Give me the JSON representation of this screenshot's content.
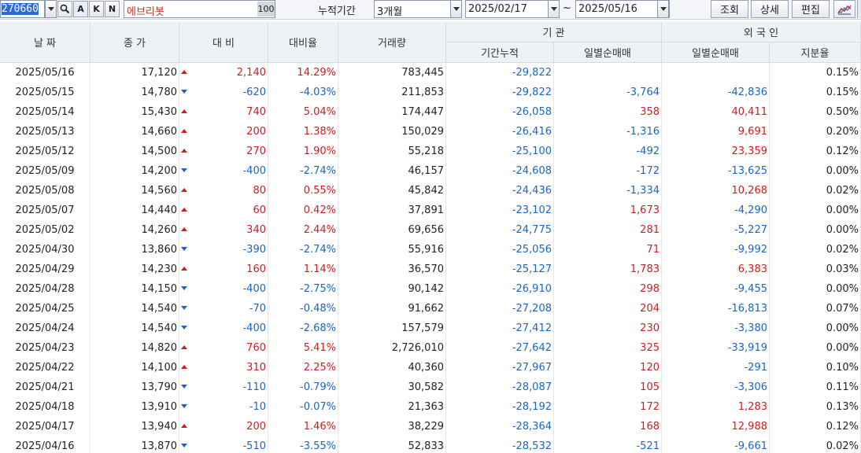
{
  "toolbar": {
    "stock_code": "270660",
    "buttons": [
      "A",
      "K",
      "N"
    ],
    "stock_name": "에브리봇",
    "count_badge": "100",
    "period_label": "누적기간",
    "period_value": "3개월",
    "date_from": "2025/02/17",
    "date_sep": "~",
    "date_to": "2025/05/16",
    "query_label": "조회",
    "detail_label": "상세",
    "edit_label": "편집"
  },
  "headers": {
    "date": "날 짜",
    "close": "종 가",
    "change": "대 비",
    "change_rate": "대비율",
    "volume": "거래량",
    "institution": "기    관",
    "inst_cum": "기간누적",
    "inst_daily": "일별순매매",
    "foreign": "외 국 인",
    "for_daily": "일별순매매",
    "for_share": "지분율"
  },
  "colors": {
    "up": "#d01d1d",
    "down": "#1a66c2",
    "header_bg": "#eef1f6"
  },
  "rows": [
    {
      "date": "2025/05/16",
      "close": "17,120",
      "dir": "up",
      "change": "2,140",
      "rate": "14.29%",
      "volume": "783,445",
      "inst_cum": "-29,822",
      "inst_daily": "",
      "for_daily": "",
      "share": "0.15%"
    },
    {
      "date": "2025/05/15",
      "close": "14,780",
      "dir": "down",
      "change": "-620",
      "rate": "-4.03%",
      "volume": "211,853",
      "inst_cum": "-29,822",
      "inst_daily": "-3,764",
      "for_daily": "-42,836",
      "share": "0.15%"
    },
    {
      "date": "2025/05/14",
      "close": "15,430",
      "dir": "up",
      "change": "740",
      "rate": "5.04%",
      "volume": "174,447",
      "inst_cum": "-26,058",
      "inst_daily": "358",
      "for_daily": "40,411",
      "share": "0.50%"
    },
    {
      "date": "2025/05/13",
      "close": "14,660",
      "dir": "up",
      "change": "200",
      "rate": "1.38%",
      "volume": "150,029",
      "inst_cum": "-26,416",
      "inst_daily": "-1,316",
      "for_daily": "9,691",
      "share": "0.20%"
    },
    {
      "date": "2025/05/12",
      "close": "14,500",
      "dir": "up",
      "change": "270",
      "rate": "1.90%",
      "volume": "55,218",
      "inst_cum": "-25,100",
      "inst_daily": "-492",
      "for_daily": "23,359",
      "share": "0.12%"
    },
    {
      "date": "2025/05/09",
      "close": "14,200",
      "dir": "down",
      "change": "-400",
      "rate": "-2.74%",
      "volume": "46,157",
      "inst_cum": "-24,608",
      "inst_daily": "-172",
      "for_daily": "-13,625",
      "share": "0.00%"
    },
    {
      "date": "2025/05/08",
      "close": "14,560",
      "dir": "up",
      "change": "80",
      "rate": "0.55%",
      "volume": "45,842",
      "inst_cum": "-24,436",
      "inst_daily": "-1,334",
      "for_daily": "10,268",
      "share": "0.02%"
    },
    {
      "date": "2025/05/07",
      "close": "14,440",
      "dir": "up",
      "change": "60",
      "rate": "0.42%",
      "volume": "37,891",
      "inst_cum": "-23,102",
      "inst_daily": "1,673",
      "for_daily": "-4,290",
      "share": "0.00%"
    },
    {
      "date": "2025/05/02",
      "close": "14,260",
      "dir": "up",
      "change": "340",
      "rate": "2.44%",
      "volume": "69,656",
      "inst_cum": "-24,775",
      "inst_daily": "281",
      "for_daily": "-5,227",
      "share": "0.00%"
    },
    {
      "date": "2025/04/30",
      "close": "13,860",
      "dir": "down",
      "change": "-390",
      "rate": "-2.74%",
      "volume": "55,916",
      "inst_cum": "-25,056",
      "inst_daily": "71",
      "for_daily": "-9,992",
      "share": "0.02%"
    },
    {
      "date": "2025/04/29",
      "close": "14,230",
      "dir": "up",
      "change": "160",
      "rate": "1.14%",
      "volume": "36,570",
      "inst_cum": "-25,127",
      "inst_daily": "1,783",
      "for_daily": "6,383",
      "share": "0.03%"
    },
    {
      "date": "2025/04/28",
      "close": "14,150",
      "dir": "down",
      "change": "-400",
      "rate": "-2.75%",
      "volume": "90,142",
      "inst_cum": "-26,910",
      "inst_daily": "298",
      "for_daily": "-9,455",
      "share": "0.00%"
    },
    {
      "date": "2025/04/25",
      "close": "14,540",
      "dir": "down",
      "change": "-70",
      "rate": "-0.48%",
      "volume": "91,662",
      "inst_cum": "-27,208",
      "inst_daily": "204",
      "for_daily": "-16,813",
      "share": "0.07%"
    },
    {
      "date": "2025/04/24",
      "close": "14,540",
      "dir": "down",
      "change": "-400",
      "rate": "-2.68%",
      "volume": "157,579",
      "inst_cum": "-27,412",
      "inst_daily": "230",
      "for_daily": "-3,380",
      "share": "0.00%"
    },
    {
      "date": "2025/04/23",
      "close": "14,820",
      "dir": "up",
      "change": "760",
      "rate": "5.41%",
      "volume": "2,726,010",
      "inst_cum": "-27,642",
      "inst_daily": "325",
      "for_daily": "-33,919",
      "share": "0.00%"
    },
    {
      "date": "2025/04/22",
      "close": "14,100",
      "dir": "up",
      "change": "310",
      "rate": "2.25%",
      "volume": "40,360",
      "inst_cum": "-27,967",
      "inst_daily": "120",
      "for_daily": "-291",
      "share": "0.10%"
    },
    {
      "date": "2025/04/21",
      "close": "13,790",
      "dir": "down",
      "change": "-110",
      "rate": "-0.79%",
      "volume": "30,582",
      "inst_cum": "-28,087",
      "inst_daily": "105",
      "for_daily": "-3,306",
      "share": "0.11%"
    },
    {
      "date": "2025/04/18",
      "close": "13,910",
      "dir": "down",
      "change": "-10",
      "rate": "-0.07%",
      "volume": "21,363",
      "inst_cum": "-28,192",
      "inst_daily": "172",
      "for_daily": "1,283",
      "share": "0.13%"
    },
    {
      "date": "2025/04/17",
      "close": "13,940",
      "dir": "up",
      "change": "200",
      "rate": "1.46%",
      "volume": "38,229",
      "inst_cum": "-28,364",
      "inst_daily": "168",
      "for_daily": "12,988",
      "share": "0.12%"
    },
    {
      "date": "2025/04/16",
      "close": "13,870",
      "dir": "down",
      "change": "-510",
      "rate": "-3.55%",
      "volume": "52,833",
      "inst_cum": "-28,532",
      "inst_daily": "-521",
      "for_daily": "-9,661",
      "share": "0.02%"
    }
  ]
}
